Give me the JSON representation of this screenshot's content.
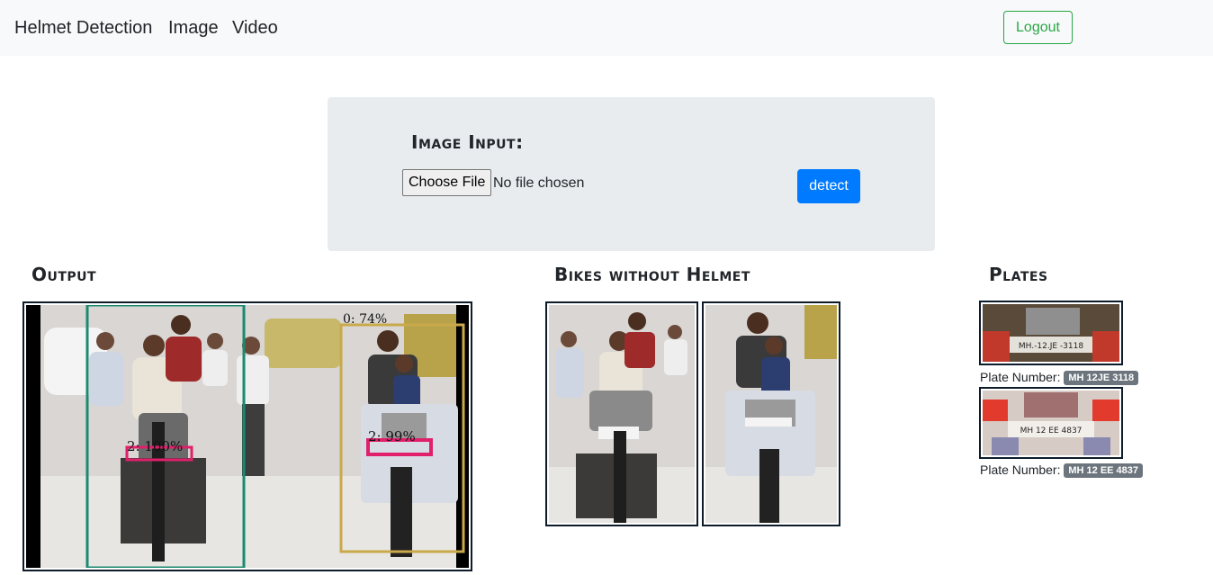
{
  "navbar": {
    "brand": "Helmet Detection",
    "links": [
      "Image",
      "Video"
    ],
    "logout_label": "Logout"
  },
  "input_panel": {
    "title": "Image Input:",
    "choose_file_label": "Choose File",
    "file_status": "No file chosen",
    "detect_label": "detect"
  },
  "output": {
    "title": "Output",
    "detections": [
      {
        "label": "2: 100%"
      },
      {
        "label": "0: 74%"
      },
      {
        "label": "2: 99%"
      }
    ]
  },
  "bikes": {
    "title": "Bikes without Helmet"
  },
  "plates": {
    "title": "Plates",
    "label": "Plate Number:",
    "items": [
      {
        "number": "MH 12JE 3118",
        "image_text": "MH.-12.JE -3118"
      },
      {
        "number": "MH 12 EE 4837",
        "image_text": "MH 12 EE 4837"
      }
    ]
  },
  "colors": {
    "primary": "#007bff",
    "success": "#28a745",
    "badge": "#6c757d",
    "navbar_bg": "#f8f9fa",
    "panel_bg": "#e9ecef",
    "box_teal": "#1a8a70",
    "box_gold": "#c9a94a",
    "box_pink": "#e0206a"
  }
}
